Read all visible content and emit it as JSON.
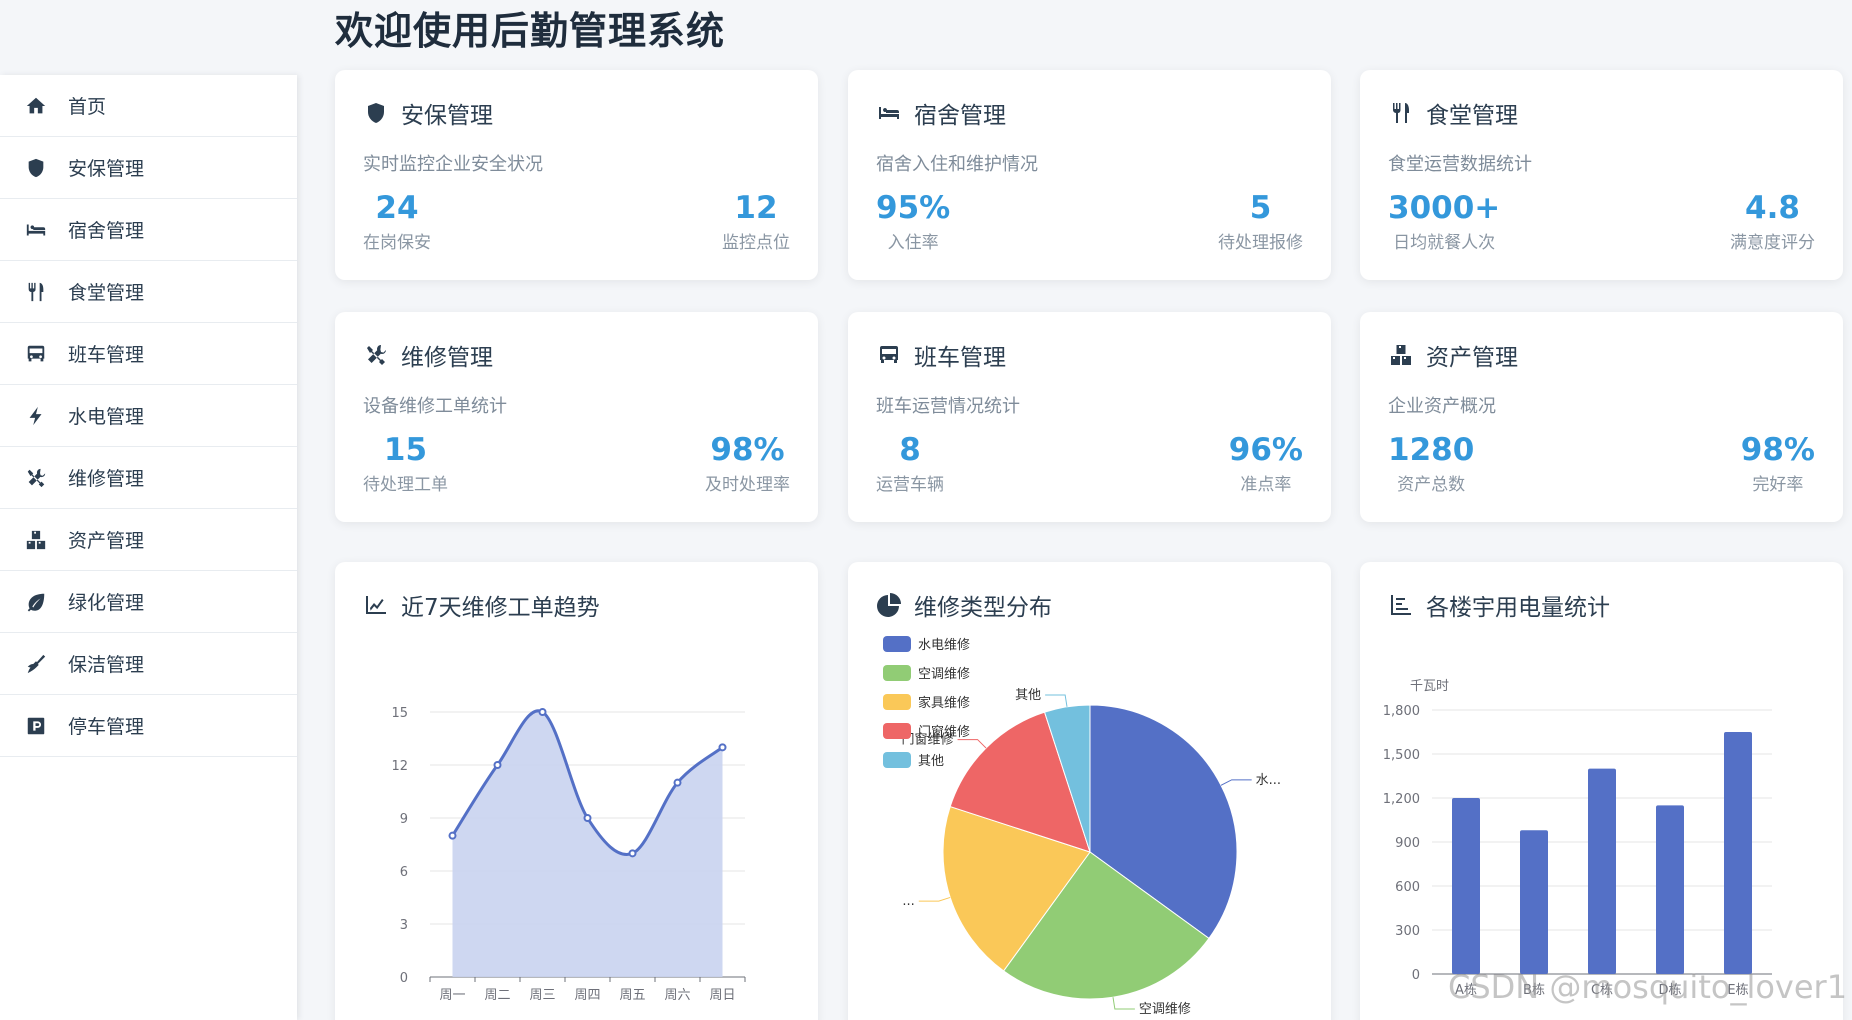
{
  "page": {
    "title": "欢迎使用后勤管理系统"
  },
  "sidebar": {
    "items": [
      {
        "label": "首页",
        "icon": "home-icon"
      },
      {
        "label": "安保管理",
        "icon": "shield-icon"
      },
      {
        "label": "宿舍管理",
        "icon": "bed-icon"
      },
      {
        "label": "食堂管理",
        "icon": "utensils-icon"
      },
      {
        "label": "班车管理",
        "icon": "bus-icon"
      },
      {
        "label": "水电管理",
        "icon": "bolt-icon"
      },
      {
        "label": "维修管理",
        "icon": "tools-icon"
      },
      {
        "label": "资产管理",
        "icon": "boxes-icon"
      },
      {
        "label": "绿化管理",
        "icon": "leaf-icon"
      },
      {
        "label": "保洁管理",
        "icon": "broom-icon"
      },
      {
        "label": "停车管理",
        "icon": "parking-icon"
      }
    ]
  },
  "cards": [
    {
      "title": "安保管理",
      "icon": "shield-icon",
      "desc": "实时监控企业安全状况",
      "stats": [
        {
          "value": "24",
          "label": "在岗保安"
        },
        {
          "value": "12",
          "label": "监控点位"
        }
      ]
    },
    {
      "title": "宿舍管理",
      "icon": "bed-icon",
      "desc": "宿舍入住和维护情况",
      "stats": [
        {
          "value": "95%",
          "label": "入住率"
        },
        {
          "value": "5",
          "label": "待处理报修"
        }
      ]
    },
    {
      "title": "食堂管理",
      "icon": "utensils-icon",
      "desc": "食堂运营数据统计",
      "stats": [
        {
          "value": "3000+",
          "label": "日均就餐人次"
        },
        {
          "value": "4.8",
          "label": "满意度评分"
        }
      ]
    },
    {
      "title": "维修管理",
      "icon": "tools-icon",
      "desc": "设备维修工单统计",
      "stats": [
        {
          "value": "15",
          "label": "待处理工单"
        },
        {
          "value": "98%",
          "label": "及时处理率"
        }
      ]
    },
    {
      "title": "班车管理",
      "icon": "bus-icon",
      "desc": "班车运营情况统计",
      "stats": [
        {
          "value": "8",
          "label": "运营车辆"
        },
        {
          "value": "96%",
          "label": "准点率"
        }
      ]
    },
    {
      "title": "资产管理",
      "icon": "boxes-icon",
      "desc": "企业资产概况",
      "stats": [
        {
          "value": "1280",
          "label": "资产总数"
        },
        {
          "value": "98%",
          "label": "完好率"
        }
      ]
    }
  ],
  "charts": {
    "trend": {
      "title": "近7天维修工单趋势",
      "icon": "line-chart-icon"
    },
    "pie": {
      "title": "维修类型分布",
      "icon": "pie-chart-icon"
    },
    "power": {
      "title": "各楼宇用电量统计",
      "icon": "bar-chart-icon"
    }
  },
  "chart_data": [
    {
      "type": "area",
      "categories": [
        "周一",
        "周二",
        "周三",
        "周四",
        "周五",
        "周六",
        "周日"
      ],
      "values": [
        8,
        12,
        15,
        9,
        7,
        11,
        13
      ],
      "ylim": [
        0,
        15
      ],
      "yticks": [
        0,
        3,
        6,
        9,
        12,
        15
      ],
      "color": "#5470c6",
      "area_color": "#c9d3ef"
    },
    {
      "type": "pie",
      "legend": "top-left",
      "slices": [
        {
          "name": "水电维修",
          "value": 35,
          "color": "#5470c6",
          "label": "水..."
        },
        {
          "name": "空调维修",
          "value": 25,
          "color": "#91cc75",
          "label": "空调维修"
        },
        {
          "name": "家具维修",
          "value": 20,
          "color": "#fac858",
          "label": "..."
        },
        {
          "name": "门窗维修",
          "value": 15,
          "color": "#ee6666",
          "label": "门窗维修"
        },
        {
          "name": "其他",
          "value": 5,
          "color": "#73c0de",
          "label": "其他"
        }
      ]
    },
    {
      "type": "bar",
      "unit": "千瓦时",
      "categories": [
        "A栋",
        "B栋",
        "C栋",
        "D栋",
        "E栋"
      ],
      "values": [
        1200,
        980,
        1400,
        1150,
        1650
      ],
      "ylim": [
        0,
        1800
      ],
      "yticks": [
        "0",
        "300",
        "600",
        "900",
        "1,200",
        "1,500",
        "1,800"
      ],
      "color": "#5470c6"
    }
  ],
  "watermark": "CSDN @mosquito_lover1"
}
